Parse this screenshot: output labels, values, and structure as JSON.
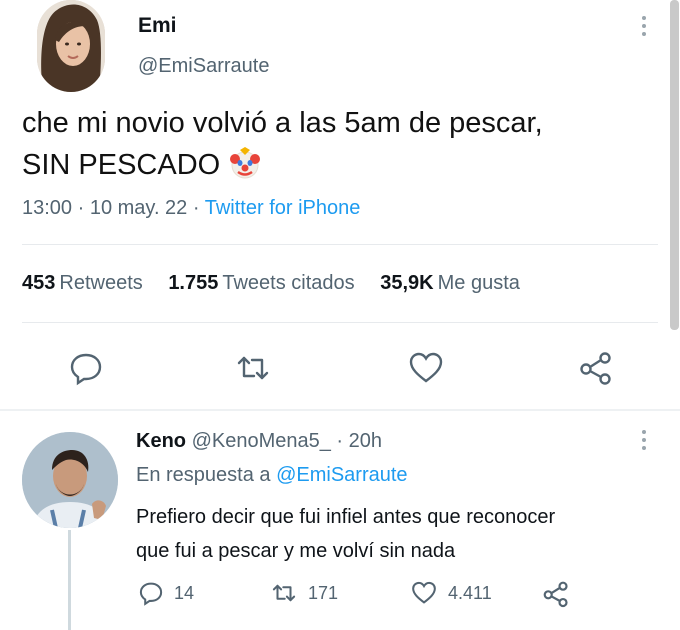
{
  "tweet": {
    "author_name": "Emi",
    "author_handle": "@EmiSarraute",
    "text_line1": "che mi novio volvió a las 5am de pescar,",
    "text_line2": "SIN PESCADO",
    "time": "13:00",
    "date": "10 may. 22",
    "source": "Twitter for iPhone",
    "retweets_count": "453",
    "retweets_label": "Retweets",
    "quotes_count": "1.755",
    "quotes_label": "Tweets citados",
    "likes_count": "35,9K",
    "likes_label": "Me gusta"
  },
  "reply": {
    "author_name": "Keno",
    "author_handle": "@KenoMena5_",
    "age": "20h",
    "in_reply_prefix": "En respuesta a",
    "in_reply_handle": "@EmiSarraute",
    "text_line1": "Prefiero decir que fui infiel antes que reconocer",
    "text_line2": "que fui a pescar y me volví sin nada",
    "replies": "14",
    "retweets": "171",
    "likes": "4.411"
  },
  "icons": {
    "reply": "reply-icon",
    "retweet": "retweet-icon",
    "like": "heart-icon",
    "share": "share-icon",
    "more": "more-vertical-icon",
    "emoji": "clown-face-emoji"
  },
  "colors": {
    "link": "#1d9bf0",
    "secondary_text": "#536471",
    "primary_text": "#0f1419"
  }
}
